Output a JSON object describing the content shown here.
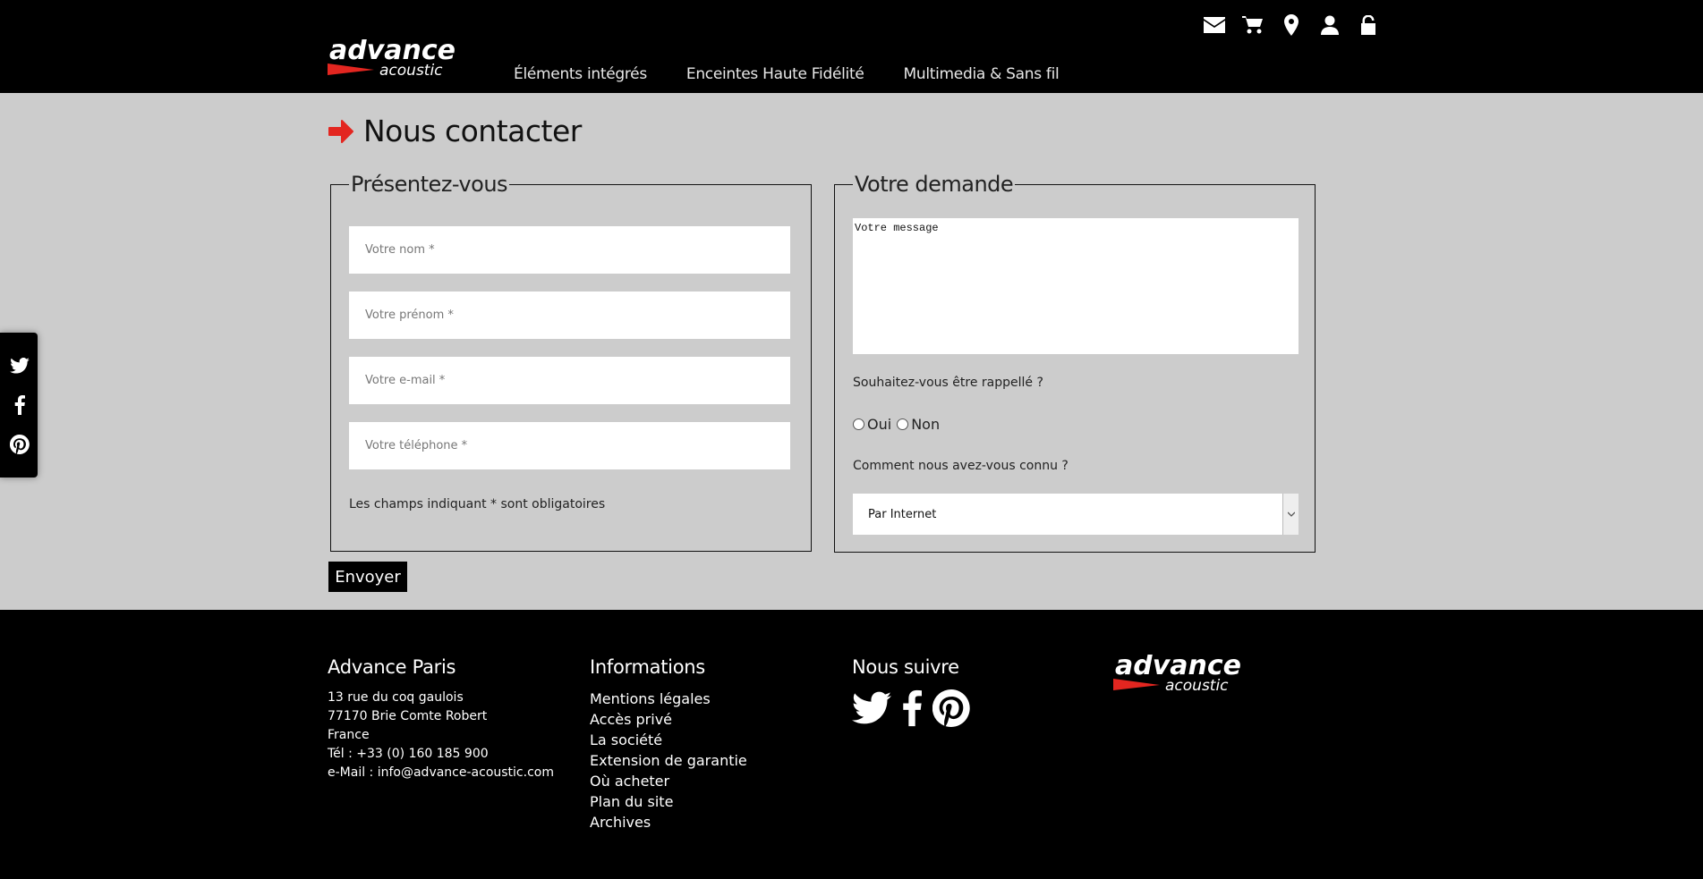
{
  "header": {
    "brand_main": "advance",
    "brand_sub": "acoustic",
    "nav": [
      "Éléments intégrés",
      "Enceintes Haute Fidélité",
      "Multimedia & Sans fil"
    ],
    "icons": [
      "envelope-icon",
      "cart-icon",
      "map-marker-icon",
      "user-icon",
      "unlock-icon"
    ]
  },
  "side_social": [
    "twitter-icon",
    "facebook-icon",
    "pinterest-icon"
  ],
  "page": {
    "title": "Nous contacter"
  },
  "form": {
    "left_legend": "Présentez-vous",
    "name_placeholder": "Votre nom *",
    "firstname_placeholder": "Votre prénom *",
    "email_placeholder": "Votre e-mail *",
    "phone_placeholder": "Votre téléphone *",
    "required_note": "Les champs indiquant * sont obligatoires",
    "right_legend": "Votre demande",
    "message_placeholder": "Votre message",
    "callback_question": "Souhaitez-vous être rappellé ?",
    "yes_label": "Oui",
    "no_label": "Non",
    "source_question": "Comment nous avez-vous connu ?",
    "source_selected": "Par Internet",
    "submit_label": "Envoyer"
  },
  "footer": {
    "company": {
      "title": "Advance Paris",
      "lines": [
        "13 rue du coq gaulois",
        "77170 Brie Comte Robert",
        "France",
        "Tél : +33 (0) 160 185 900",
        "e-Mail : info@advance-acoustic.com"
      ]
    },
    "info": {
      "title": "Informations",
      "links": [
        "Mentions légales",
        "Accès privé",
        "La société",
        "Extension de garantie",
        "Où acheter",
        "Plan du site",
        "Archives"
      ]
    },
    "follow": {
      "title": "Nous suivre"
    },
    "brand_main": "advance",
    "brand_sub": "acoustic"
  },
  "colors": {
    "accent": "#e32620",
    "background": "#cccccc",
    "header": "#000000"
  }
}
